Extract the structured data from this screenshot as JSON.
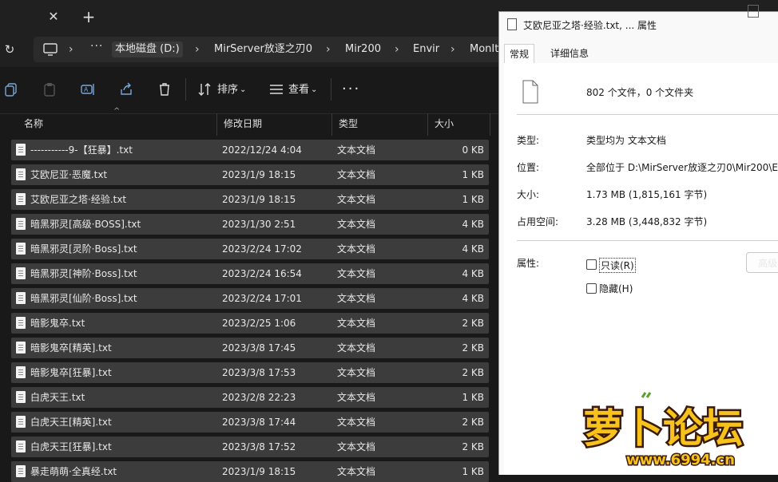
{
  "tabbar": {
    "close_glyph": "✕",
    "new_tab_glyph": "+"
  },
  "address": {
    "refresh_glyph": "↻",
    "chevron": "›",
    "overflow": "···",
    "crumbs": [
      "本地磁盘 (D:)",
      "MirServer放逐之刃0",
      "Mir200",
      "Envir",
      "MonIt"
    ]
  },
  "toolbar": {
    "sort_label": "排序",
    "view_label": "查看",
    "more_label": "···",
    "dropdown_glyph": "⌄",
    "icons": [
      "copy-icon",
      "paste-icon",
      "rename-icon",
      "share-icon",
      "delete-icon",
      "sort-icon",
      "view-icon"
    ]
  },
  "columns": {
    "name": "名称",
    "date": "修改日期",
    "type": "类型",
    "size": "大小",
    "sort_glyph": "^"
  },
  "files": [
    {
      "name": "-----------9-【狂暴】.txt",
      "date": "2022/12/24 4:04",
      "type": "文本文档",
      "size": "0 KB"
    },
    {
      "name": "艾欧尼亚·恶魔.txt",
      "date": "2023/1/9 18:15",
      "type": "文本文档",
      "size": "1 KB"
    },
    {
      "name": "艾欧尼亚之塔·经验.txt",
      "date": "2023/1/9 18:15",
      "type": "文本文档",
      "size": "1 KB"
    },
    {
      "name": "暗黑邪灵[高级·BOSS].txt",
      "date": "2023/1/30 2:51",
      "type": "文本文档",
      "size": "4 KB"
    },
    {
      "name": "暗黑邪灵[灵阶·Boss].txt",
      "date": "2023/2/24 17:02",
      "type": "文本文档",
      "size": "4 KB"
    },
    {
      "name": "暗黑邪灵[神阶·Boss].txt",
      "date": "2023/2/24 16:54",
      "type": "文本文档",
      "size": "4 KB"
    },
    {
      "name": "暗黑邪灵[仙阶·Boss].txt",
      "date": "2023/2/24 17:01",
      "type": "文本文档",
      "size": "4 KB"
    },
    {
      "name": "暗影鬼卒.txt",
      "date": "2023/2/25 1:06",
      "type": "文本文档",
      "size": "2 KB"
    },
    {
      "name": "暗影鬼卒[精英].txt",
      "date": "2023/3/8 17:45",
      "type": "文本文档",
      "size": "2 KB"
    },
    {
      "name": "暗影鬼卒[狂暴].txt",
      "date": "2023/3/8 17:53",
      "type": "文本文档",
      "size": "2 KB"
    },
    {
      "name": "白虎天王.txt",
      "date": "2023/2/8 22:23",
      "type": "文本文档",
      "size": "1 KB"
    },
    {
      "name": "白虎天王[精英].txt",
      "date": "2023/3/8 17:44",
      "type": "文本文档",
      "size": "2 KB"
    },
    {
      "name": "白虎天王[狂暴].txt",
      "date": "2023/3/8 17:52",
      "type": "文本文档",
      "size": "2 KB"
    },
    {
      "name": "暴走萌萌·全真经.txt",
      "date": "2023/1/9 18:15",
      "type": "文本文档",
      "size": "1 KB"
    }
  ],
  "dialog": {
    "title": "艾欧尼亚之塔·经验.txt, ... 属性",
    "tab_general": "常规",
    "tab_details": "详细信息",
    "summary": "802 个文件，0 个文件夹",
    "type_label": "类型:",
    "type_value": "类型均为 文本文档",
    "location_label": "位置:",
    "location_value": "全部位于 D:\\MirServer放逐之刃0\\Mir200\\E",
    "size_label": "大小:",
    "size_value": "1.73 MB (1,815,161 字节)",
    "disk_label": "占用空间:",
    "disk_value": "3.28 MB (3,448,832 字节)",
    "attr_label": "属性:",
    "readonly_label": "只读(R)",
    "hidden_label": "隐藏(H)",
    "advanced_label": "高级"
  },
  "watermark": {
    "brand": "萝卜论坛",
    "url": "www.6994.cn"
  }
}
